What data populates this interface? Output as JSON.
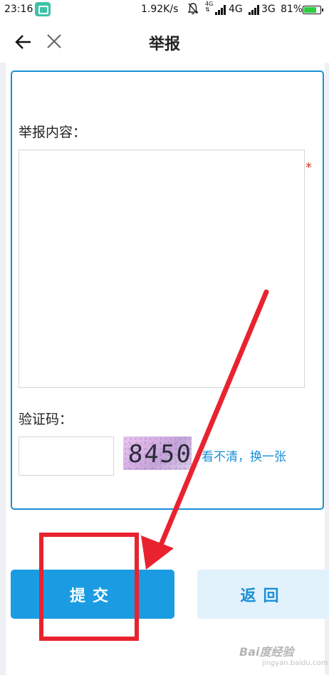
{
  "status_bar": {
    "time": "23:16",
    "network_speed": "1.92K/s",
    "net1_top": "4G",
    "net1_bottom": "⇅",
    "sim1_label": "4G",
    "sim2_label": "3G",
    "battery_percent": "81%",
    "battery_level": 0.81,
    "icons": [
      "screenshot-app-icon",
      "bell-muted-icon",
      "signal-icon",
      "battery-icon"
    ]
  },
  "header": {
    "title": "举报",
    "back_icon": "arrow-left-icon",
    "close_icon": "close-icon"
  },
  "form": {
    "content_label": "举报内容：",
    "content_value": "",
    "required_mark": "*",
    "captcha_label": "验证码：",
    "captcha_value": "",
    "captcha_image_text": "8450",
    "refresh_link": "看不清，换一张"
  },
  "buttons": {
    "submit_label": "提交",
    "return_label": "返回"
  },
  "watermark": {
    "text": "Bai度经验",
    "sub": "jingyan.baidu.com"
  },
  "colors": {
    "accent": "#1b9ce2",
    "card_border": "#1a8fd6",
    "return_bg": "#e2f2fc",
    "required": "#d9362a",
    "annotation": "#e8232f"
  }
}
